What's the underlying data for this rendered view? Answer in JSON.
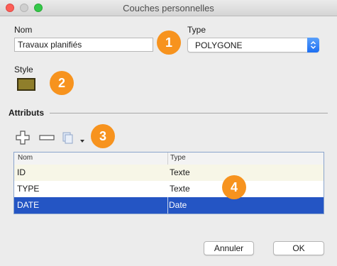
{
  "window": {
    "title": "Couches personnelles"
  },
  "fields": {
    "nom_label": "Nom",
    "nom_value": "Travaux planifiés",
    "type_label": "Type",
    "type_value": "POLYGONE",
    "style_label": "Style",
    "style_color": "#8f7e2b"
  },
  "attributes": {
    "section_label": "Attributs",
    "columns": [
      "Nom",
      "Type"
    ],
    "rows": [
      {
        "name": "ID",
        "type": "Texte"
      },
      {
        "name": "TYPE",
        "type": "Texte"
      },
      {
        "name": "DATE",
        "type": "Date"
      }
    ]
  },
  "badges": [
    "1",
    "2",
    "3",
    "4"
  ],
  "buttons": {
    "cancel": "Annuler",
    "ok": "OK"
  },
  "colors": {
    "badge": "#f7931e",
    "selection": "#2455c4",
    "accent": "#1d6ff2"
  }
}
